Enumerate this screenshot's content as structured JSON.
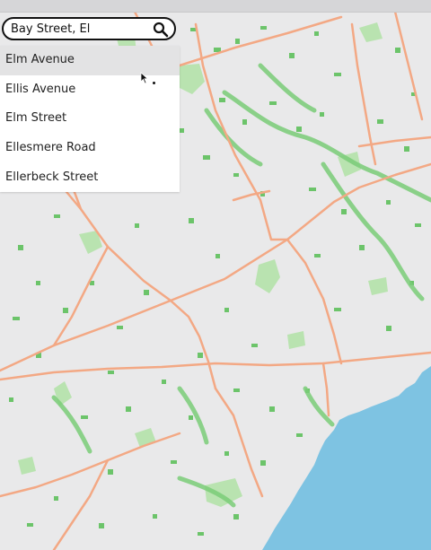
{
  "search": {
    "value": "Bay Street, El",
    "suggestions": [
      "Elm Avenue",
      "Ellis Avenue",
      "Elm Street",
      "Ellesmere Road",
      "Ellerbeck Street"
    ],
    "highlighted_index": 0
  },
  "icons": {
    "search": "search-icon",
    "cursor": "mouse-pointer-icon"
  },
  "colors": {
    "land": "#e9e9ea",
    "road": "#f3a884",
    "park_light": "#b9e3b0",
    "park_dark": "#5fbf5f",
    "water": "#7ec3e2"
  }
}
